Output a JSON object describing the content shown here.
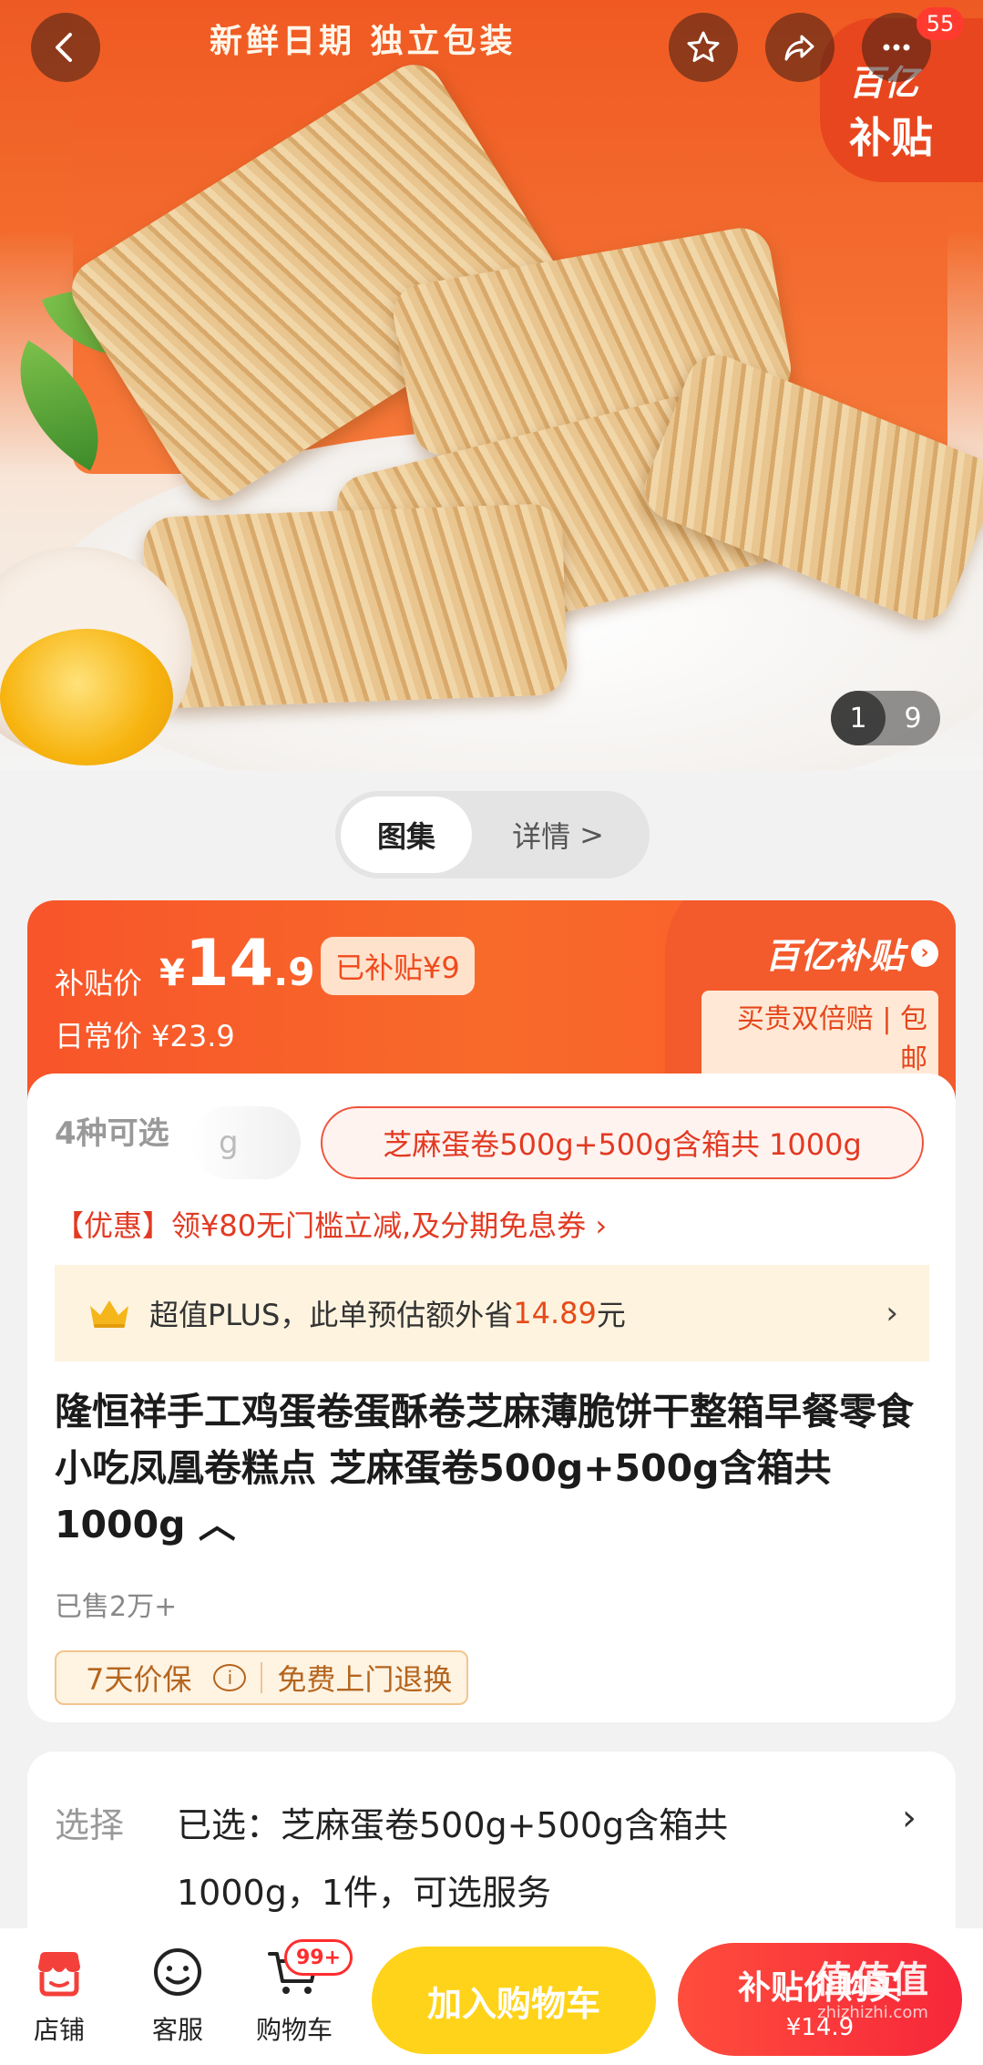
{
  "hero": {
    "banner_text": "新鲜日期  独立包装",
    "badge_count": "55",
    "corner_brand_line1": "百亿",
    "corner_brand_line2": "补贴",
    "pager_current": "1",
    "pager_total": "9"
  },
  "view_switch": {
    "gallery": "图集",
    "details": "详情",
    "details_arrow": ">"
  },
  "price": {
    "subsidy_label": "补贴价",
    "currency": "¥",
    "integer": "14",
    "decimal": ".9",
    "subsidy_tag": "已补贴¥9",
    "daily_price": "日常价 ¥23.9",
    "brand_title": "百亿补贴",
    "brand_arrow": "›",
    "brand_sub": "买贵双倍赔 | 包邮"
  },
  "product": {
    "options_count": "4种可选",
    "options_fade": "g",
    "selected_option": "芝麻蛋卷500g+500g含箱共 1000g",
    "promo": "【优惠】领¥80无门槛立减,及分期免息券 ›",
    "plus_prefix": "超值PLUS，此单预估额外省",
    "plus_amount": "14.89",
    "plus_suffix": "元",
    "plus_arrow": "›",
    "title": "隆恒祥手工鸡蛋卷蛋酥卷芝麻薄脆饼干整箱早餐零食小吃凤凰卷糕点 芝麻蛋卷500g+500g含箱共 1000g ︿",
    "sold": "已售2万+",
    "guarantee_1": "7天价保",
    "guarantee_info": "i",
    "guarantee_2": "免费上门退换"
  },
  "selection": {
    "label": "选择",
    "value": "已选：芝麻蛋卷500g+500g含箱共 1000g，1件，可选服务",
    "arrow": "›"
  },
  "bottom_bar": {
    "store": "店铺",
    "service": "客服",
    "cart": "购物车",
    "cart_badge": "99+",
    "add_to_cart": "加入购物车",
    "buy_label": "补贴价购买",
    "buy_price": "¥14.9"
  },
  "watermark": {
    "line1": "值值值",
    "line2": "zhizhizhi.com"
  },
  "colors": {
    "accent": "#f8552a",
    "buy_button": "#f6273a",
    "cart_button": "#ffd319",
    "promo_red": "#e23a22"
  },
  "icons": [
    "back-icon",
    "star-icon",
    "share-icon",
    "more-icon",
    "store-icon",
    "service-icon",
    "cart-icon",
    "crown-icon"
  ]
}
